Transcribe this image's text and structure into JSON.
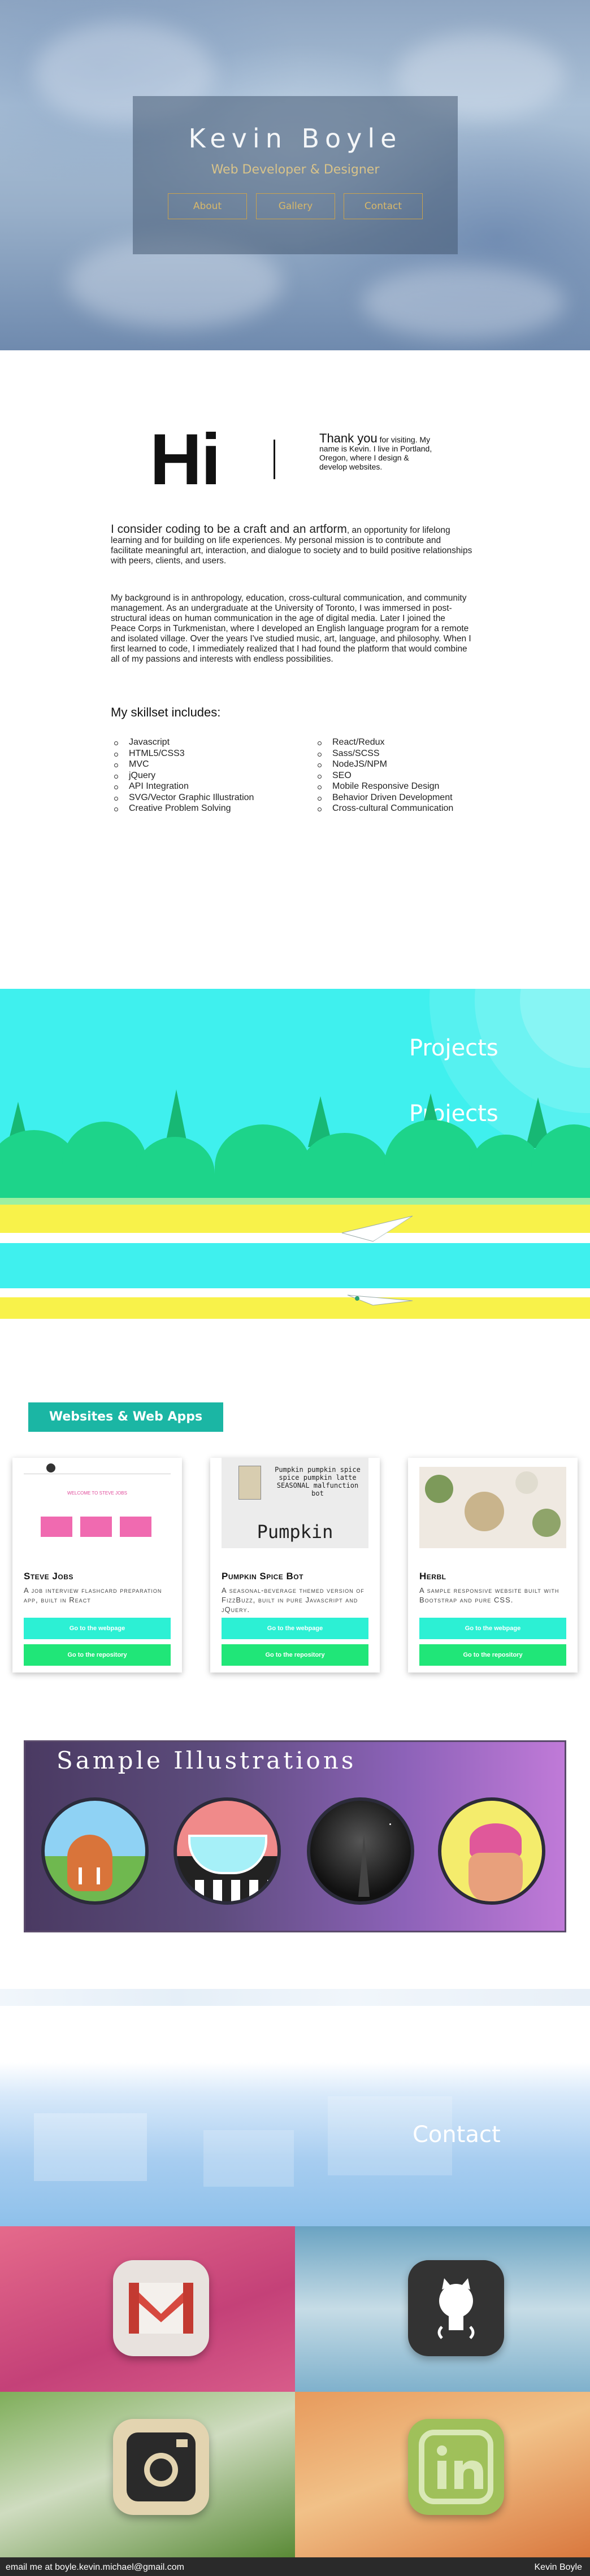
{
  "hero": {
    "name": "Kevin Boyle",
    "subtitle": "Web Developer & Designer",
    "nav": [
      {
        "label": "About"
      },
      {
        "label": "Gallery"
      },
      {
        "label": "Contact"
      }
    ]
  },
  "about": {
    "greeting": "Hi",
    "thank_you_big": "Thank you",
    "thank_you_rest": " for visiting. My name is Kevin. I live in Portland, Oregon, where I design & develop websites.",
    "lead_strong": "I consider coding to be a craft and an artform",
    "lead_rest": ", an opportunity for lifelong learning and for building on life experiences. My personal mission is to contribute and facilitate meaningful art, interaction, and dialogue to society and to build positive relationships with peers, clients, and users.",
    "background": "My background is in anthropology, education, cross-cultural communication, and community management. As an undergraduate at the University of Toronto, I was immersed in post-structural ideas on human communication in the age of digital media. Later I joined the Peace Corps in Turkmenistan, where I developed an English language program for a remote and isolated village. Over the years I've studied music, art, language, and philosophy. When I first learned to code, I immediately realized that I had found the platform that would combine all of my passions and interests with endless possibilities.",
    "skills_heading": "My skillset includes:",
    "skills_left": [
      "Javascript",
      "HTML5/CSS3",
      "MVC",
      "jQuery",
      "API Integration",
      "SVG/Vector Graphic Illustration",
      "Creative Problem Solving"
    ],
    "skills_right": [
      "React/Redux",
      "Sass/SCSS",
      "NodeJS/NPM",
      "SEO",
      "Mobile Responsive Design",
      "Behavior Driven Development",
      "Cross-cultural Communication"
    ]
  },
  "projects_banner": {
    "title_top": "Projects",
    "title_bottom": "Projects"
  },
  "cards_section": {
    "tag": "Websites & Web Apps",
    "cards": [
      {
        "title": "Steve Jobs",
        "desc": "A job interview flashcard preparation app, built in React",
        "web_btn": "Go to the webpage",
        "repo_btn": "Go to the repository",
        "thumb_header": "WELCOME TO STEVE JOBS"
      },
      {
        "title": "Pumpkin Spice Bot",
        "desc": "A seasonal-beverage themed version of FizzBuzz, built in pure Javascript and jQuery.",
        "web_btn": "Go to the webpage",
        "repo_btn": "Go to the repository",
        "thumb_text": "Pumpkin pumpkin spice spice pumpkin latte SEASONAL malfunction bot",
        "thumb_word": "Pumpkin"
      },
      {
        "title": "Herbl",
        "desc": "A sample responsive website built with Bootstrap and pure CSS.",
        "web_btn": "Go to the webpage",
        "repo_btn": "Go to the repository"
      }
    ]
  },
  "illustrations": {
    "title": "Sample Illustrations"
  },
  "contact": {
    "title": "Contact",
    "tiles": [
      {
        "name": "gmail",
        "icon": "gmail-icon",
        "bg": "#d94a7a"
      },
      {
        "name": "github",
        "icon": "github-icon",
        "bg": "#8fb7c9"
      },
      {
        "name": "instagram",
        "icon": "instagram-icon",
        "bg": "#5e8d3e"
      },
      {
        "name": "linkedin",
        "icon": "linkedin-icon",
        "bg": "#e0894a"
      }
    ]
  },
  "footer": {
    "email": "email me at boyle.kevin.michael@gmail.com",
    "name": "Kevin Boyle"
  }
}
